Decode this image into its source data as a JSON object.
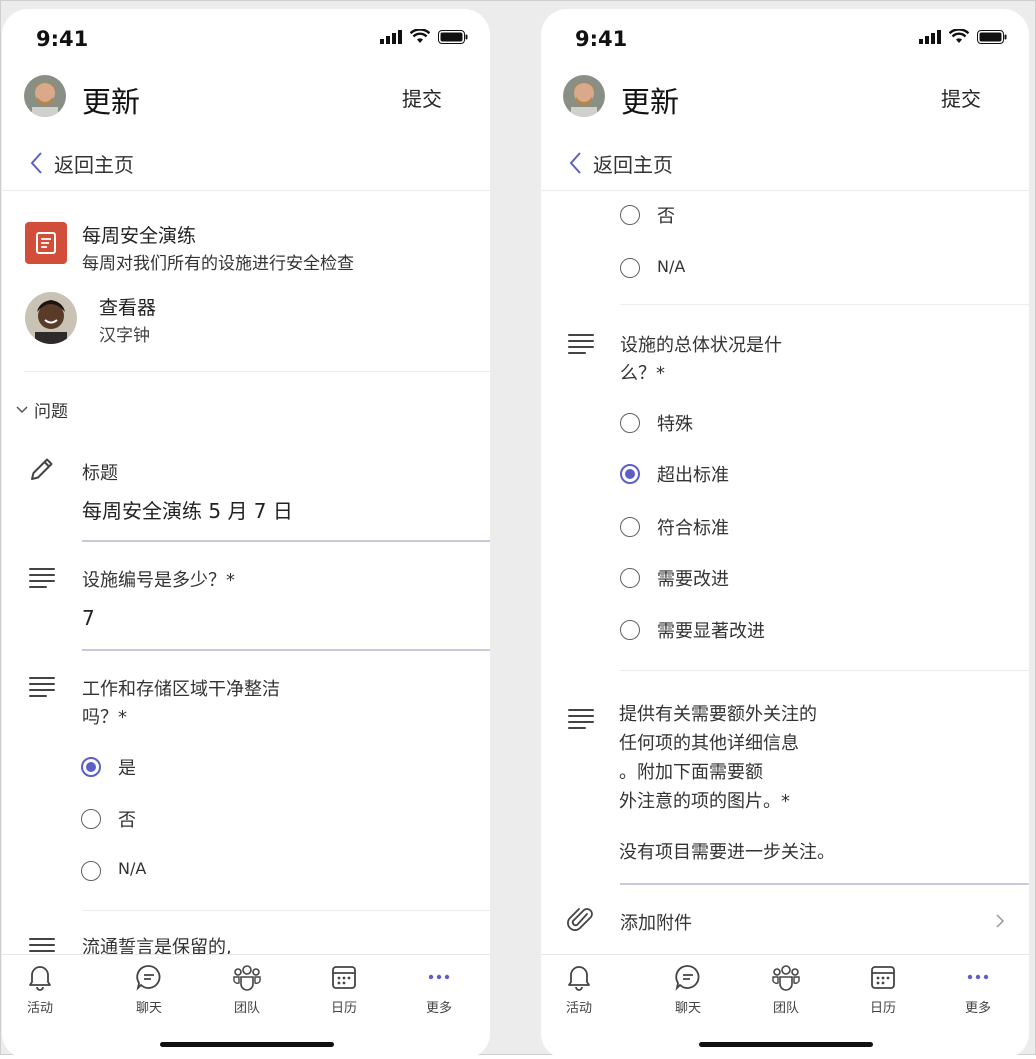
{
  "status": {
    "time": "9:41"
  },
  "header": {
    "title": "更新",
    "submit_label": "提交",
    "back_label": "返回主页"
  },
  "left": {
    "task": {
      "title": "每周安全演练",
      "subtitle": "每周对我们所有的设施进行安全检查"
    },
    "viewer": {
      "label": "查看器",
      "name": "汉字钟"
    },
    "section_label": "问题",
    "title_field": {
      "label": "标题",
      "value": "每周安全演练 5 月 7 日"
    },
    "q1": {
      "label": "设施编号是多少？*",
      "value": "7"
    },
    "q2": {
      "line1": "工作和存储区域干净整洁",
      "line2": "吗？*",
      "options": [
        "是",
        "否",
        "N/A"
      ],
      "selected": "是"
    },
    "q3": {
      "partial": "流通誓言是保留的,"
    }
  },
  "right": {
    "prev_options": [
      "否",
      "N/A"
    ],
    "q4": {
      "line1": "设施的总体状况是什",
      "line2": "么？*",
      "options": [
        "特殊",
        "超出标准",
        "符合标准",
        "需要改进",
        "需要显著改进"
      ],
      "selected": "超出标准"
    },
    "q5": {
      "line1": "提供有关需要额外关注的",
      "line2": "任何项的其他详细信息",
      "line3": "。附加下面需要额",
      "line4": "外注意的项的图片。*",
      "answer": "没有项目需要进一步关注。"
    },
    "attachment_label": "添加附件"
  },
  "tabs": [
    {
      "label": "活动",
      "icon": "bell-icon"
    },
    {
      "label": "聊天",
      "icon": "chat-icon"
    },
    {
      "label": "团队",
      "icon": "teams-icon"
    },
    {
      "label": "日历",
      "icon": "calendar-icon"
    },
    {
      "label": "更多",
      "icon": "more-icon"
    }
  ],
  "colors": {
    "accent": "#5b5fc7",
    "task_icon": "#d24e3b"
  }
}
